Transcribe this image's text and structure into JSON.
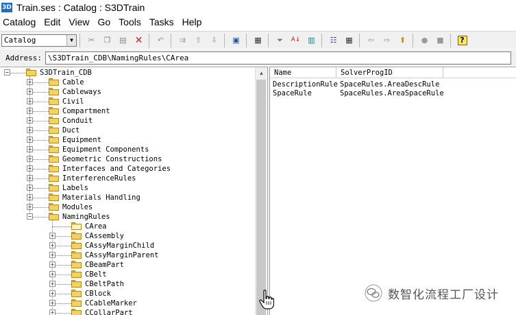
{
  "window": {
    "app_icon_label": "3D",
    "title": "Train.ses : Catalog : S3DTrain"
  },
  "menu": [
    "Catalog",
    "Edit",
    "View",
    "Go",
    "Tools",
    "Tasks",
    "Help"
  ],
  "toolbar": {
    "task_combo_value": "Catalog",
    "buttons": [
      "cut-icon",
      "copy-icon",
      "paste-icon",
      "delete-icon",
      "undo-icon",
      "insert-row-icon",
      "move-up-icon",
      "move-down-icon",
      "properties-icon",
      "tab-icon",
      "filter-icon",
      "sort-icon",
      "check-data-icon",
      "list-view-icon",
      "grid-view-icon",
      "back-icon",
      "forward-icon",
      "up-folder-icon",
      "refresh-icon",
      "refresh-all-icon",
      "help-icon"
    ]
  },
  "address": {
    "label": "Address:",
    "value": "\\S3DTrain_CDB\\NamingRules\\CArea"
  },
  "tree": {
    "root": "S3DTrain_CDB",
    "level1": [
      "Cable",
      "Cableways",
      "Civil",
      "Compartment",
      "Conduit",
      "Duct",
      "Equipment",
      "Equipment Components",
      "Geometric Constructions",
      "Interfaces and Categories",
      "InterferenceRules",
      "Labels",
      "Materials Handling",
      "Modules",
      "NamingRules"
    ],
    "naming_rules_children": [
      "CArea",
      "CAssembly",
      "CAssyMarginChild",
      "CAssyMarginParent",
      "CBeamPart",
      "CBelt",
      "CBeltPath",
      "CBlock",
      "CCableMarker",
      "CCollarPart"
    ]
  },
  "list": {
    "columns": [
      "Name",
      "SolverProgID"
    ],
    "rows": [
      {
        "name": "DescriptionRule",
        "prog_id": "SpaceRules.AreaDescRule"
      },
      {
        "name": "SpaceRule",
        "prog_id": "SpaceRules.AreaSpaceRule"
      }
    ]
  },
  "watermark": {
    "text": "数智化流程工厂设计"
  }
}
